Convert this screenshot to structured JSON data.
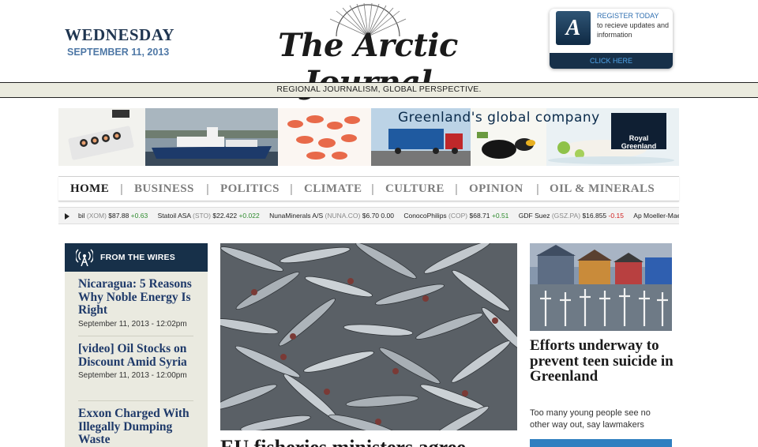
{
  "header": {
    "day": "WEDNESDAY",
    "date": "SEPTEMBER 11, 2013",
    "masthead": "The Arctic Journal",
    "tagline": "REGIONAL JOURNALISM, GLOBAL PERSPECTIVE."
  },
  "register": {
    "logo_letter": "A",
    "title": "REGISTER TODAY",
    "text": "to recieve updates and information",
    "cta": "CLICK HERE"
  },
  "banner": {
    "slogan": "Greenland's global company",
    "brand": "Royal Greenland"
  },
  "nav": {
    "items": [
      "HOME",
      "BUSINESS",
      "POLITICS",
      "CLIMATE",
      "CULTURE",
      "OPINION",
      "OIL & MINERALS"
    ],
    "active": "HOME",
    "separator": "|"
  },
  "ticker": {
    "items": [
      {
        "name": "bil",
        "symbol": "(XOM)",
        "price": "$87.88",
        "change": "+0.63",
        "direction": "up"
      },
      {
        "name": "Statoil ASA",
        "symbol": "(STO)",
        "price": "$22.422",
        "change": "+0.022",
        "direction": "up"
      },
      {
        "name": "NunaMinerals A/S",
        "symbol": "(NUNA.CO)",
        "price": "$6.70",
        "change": "0.00",
        "direction": "flat"
      },
      {
        "name": "ConocoPhilips",
        "symbol": "(COP)",
        "price": "$68.71",
        "change": "+0.51",
        "direction": "up"
      },
      {
        "name": "GDF Suez",
        "symbol": "(GSZ.PA)",
        "price": "$16.855",
        "change": "-0.15",
        "direction": "down"
      },
      {
        "name": "Ap Moeller-Maersk A/",
        "symbol": "",
        "price": "",
        "change": "",
        "direction": "flat"
      }
    ]
  },
  "wires": {
    "title": "FROM THE WIRES",
    "items": [
      {
        "headline": "Nicaragua: 5 Reasons Why Noble Energy Is Right",
        "time": "September 11, 2013 - 12:02pm"
      },
      {
        "headline": "[video] Oil Stocks on Discount Amid Syria",
        "time": "September 11, 2013 - 12:00pm"
      },
      {
        "headline": "Exxon Charged With Illegally Dumping Waste",
        "time": ""
      }
    ]
  },
  "main_story": {
    "headline": "EU fisheries ministers agree"
  },
  "side_story": {
    "headline": "Efforts underway to prevent teen suicide in Greenland",
    "dek": "Too many young people see no other way out, say lawmakers"
  },
  "colors": {
    "navy": "#173049",
    "date_blue": "#4f78a6",
    "wire_link": "#1f3a6a",
    "tagline_bg": "#ebebdf",
    "ticker_up": "#2e8b2e",
    "ticker_down": "#d02020"
  }
}
